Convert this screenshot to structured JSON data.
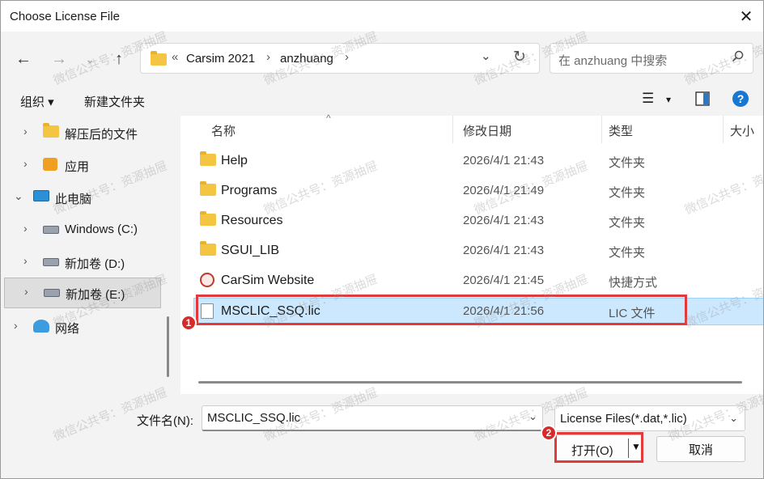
{
  "window": {
    "title": "Choose License File",
    "close": "✕"
  },
  "nav": {
    "back": "←",
    "forward": "→",
    "dropdown": "⌄",
    "up": "↑",
    "address": {
      "overflow": "«",
      "crumbs": [
        "Carsim 2021",
        "anzhuang"
      ],
      "separator": "›",
      "dropdown": "⌄",
      "refresh": "↻"
    },
    "search_placeholder": "在 anzhuang 中搜索",
    "search_icon": "search-icon"
  },
  "toolbar": {
    "organize": "组织 ▾",
    "new_folder": "新建文件夹",
    "view": "☰",
    "view_dd": "▾",
    "preview": "▣",
    "help": "?"
  },
  "sidebar": {
    "items": [
      {
        "label": "解压后的文件",
        "icon": "folder-icon",
        "chevron": "›",
        "selected": false
      },
      {
        "label": "应用",
        "icon": "app-folder-icon",
        "chevron": "›",
        "selected": false
      },
      {
        "label": "此电脑",
        "icon": "computer-icon",
        "chevron": "⌄",
        "selected": false
      },
      {
        "label": "Windows (C:)",
        "icon": "drive-icon",
        "chevron": "›",
        "selected": false
      },
      {
        "label": "新加卷 (D:)",
        "icon": "drive-icon",
        "chevron": "›",
        "selected": false
      },
      {
        "label": "新加卷 (E:)",
        "icon": "drive-icon",
        "chevron": "›",
        "selected": true
      },
      {
        "label": "网络",
        "icon": "network-icon",
        "chevron": "›",
        "selected": false
      }
    ]
  },
  "columns": {
    "name": "名称",
    "date": "修改日期",
    "type": "类型",
    "size": "大小",
    "sort": "^"
  },
  "files": [
    {
      "name": "Help",
      "date": "2026/4/1 21:43",
      "type": "文件夹",
      "icon": "folder-icon",
      "selected": false
    },
    {
      "name": "Programs",
      "date": "2026/4/1 21:49",
      "type": "文件夹",
      "icon": "folder-icon",
      "selected": false
    },
    {
      "name": "Resources",
      "date": "2026/4/1 21:43",
      "type": "文件夹",
      "icon": "folder-icon",
      "selected": false
    },
    {
      "name": "SGUI_LIB",
      "date": "2026/4/1 21:43",
      "type": "文件夹",
      "icon": "folder-icon",
      "selected": false
    },
    {
      "name": "CarSim Website",
      "date": "2026/4/1 21:45",
      "type": "快捷方式",
      "icon": "shortcut-icon",
      "selected": false
    },
    {
      "name": "MSCLIC_SSQ.lic",
      "date": "2026/4/1 21:56",
      "type": "LIC 文件",
      "icon": "file-icon",
      "selected": true
    }
  ],
  "bottom": {
    "filename_label": "文件名(N):",
    "filename_value": "MSCLIC_SSQ.lic",
    "filename_dd": "⌄",
    "filter": "License Files(*.dat,*.lic)",
    "filter_dd": "⌄",
    "open": "打开(O)",
    "open_arrow": "▼",
    "cancel": "取消"
  },
  "annotations": {
    "badge1": "1",
    "badge2": "2",
    "color": "#e23a3a"
  },
  "watermark": "微信公共号：资源抽屉"
}
